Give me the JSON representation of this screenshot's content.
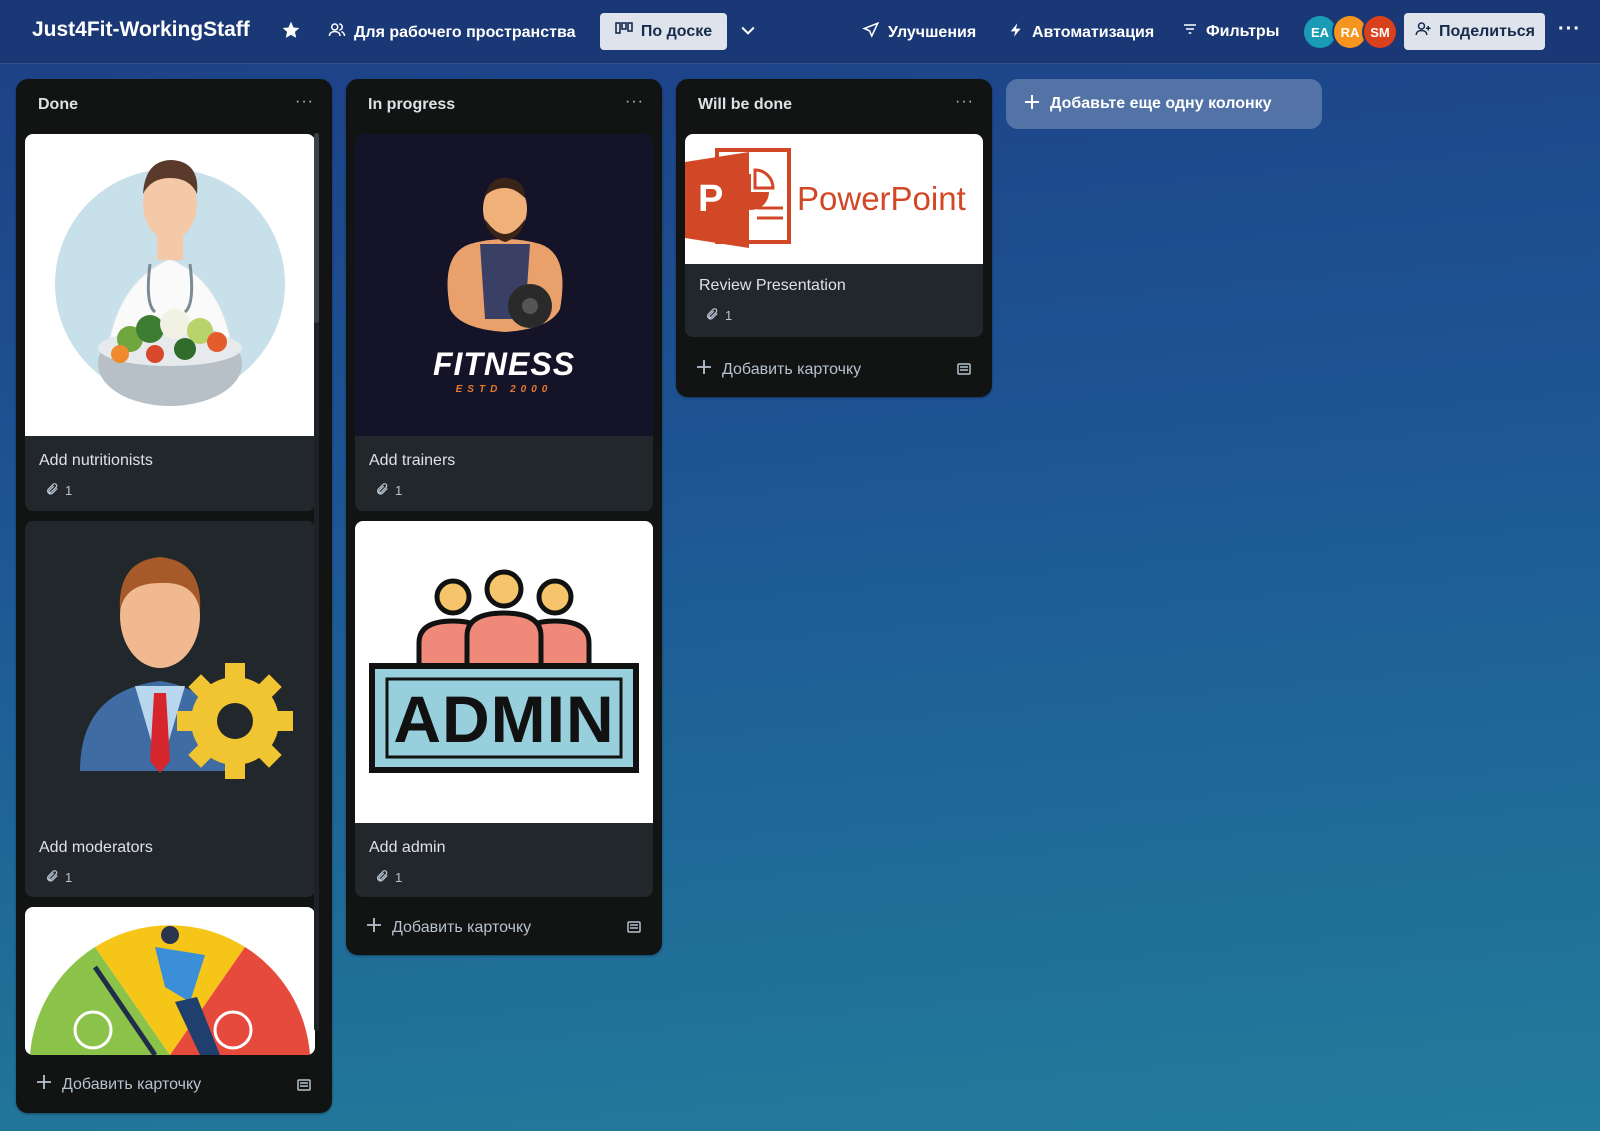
{
  "header": {
    "board_title": "Just4Fit-WorkingStaff",
    "workspace_label": "Для рабочего пространства",
    "view_label": "По доске",
    "powerups_label": "Улучшения",
    "automation_label": "Автоматизация",
    "filters_label": "Фильтры",
    "members": [
      "EA",
      "RA",
      "SM"
    ],
    "share_label": "Поделиться"
  },
  "lists": [
    {
      "title": "Done",
      "cards": [
        {
          "title": "Add nutritionists",
          "attachments": "1"
        },
        {
          "title": "Add moderators",
          "attachments": "1"
        }
      ],
      "add_card_label": "Добавить карточку"
    },
    {
      "title": "In progress",
      "cards": [
        {
          "title": "Add trainers",
          "attachments": "1",
          "cover_text": "FITNESS",
          "cover_subtext": "ESTD 2000"
        },
        {
          "title": "Add admin",
          "attachments": "1",
          "cover_text": "ADMIN"
        }
      ],
      "add_card_label": "Добавить карточку"
    },
    {
      "title": "Will be done",
      "cards": [
        {
          "title": "Review Presentation",
          "attachments": "1",
          "cover_text": "PowerPoint"
        }
      ],
      "add_card_label": "Добавить карточку"
    }
  ],
  "add_list_label": "Добавьте еще одну колонку",
  "colors": {
    "header_bg": "#1b3876",
    "list_bg": "#111413",
    "card_bg": "#22272b",
    "avatar_ea": "#1a9bb5",
    "avatar_ra": "#f5941e",
    "avatar_sm": "#d9401c"
  }
}
